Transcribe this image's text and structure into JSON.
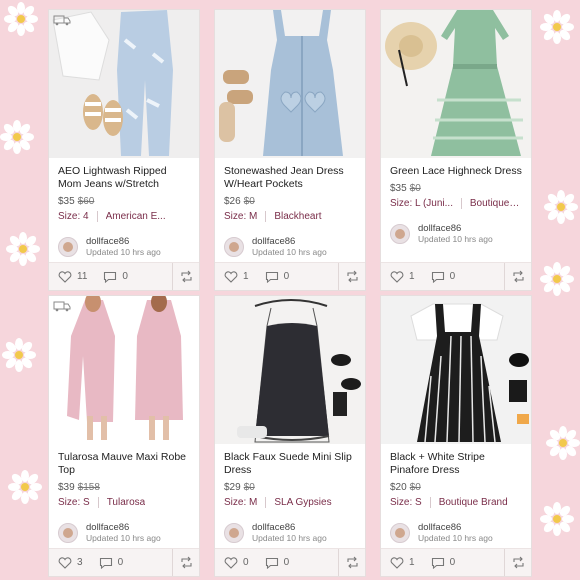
{
  "listings": [
    {
      "title": "AEO Lightwash Ripped Mom Jeans w/Stretch",
      "price": "$35",
      "original_price": "$60",
      "size": "Size: 4",
      "brand": "American E...",
      "likes": "11",
      "comments": "0",
      "seller": "dollface86",
      "updated": "Updated 10 hrs ago",
      "ship_badge": true
    },
    {
      "title": "Stonewashed Jean Dress W/Heart Pockets",
      "price": "$26",
      "original_price": "$0",
      "size": "Size: M",
      "brand": "Blackheart",
      "likes": "1",
      "comments": "0",
      "seller": "dollface86",
      "updated": "Updated 10 hrs ago",
      "ship_badge": false
    },
    {
      "title": "Green Lace Highneck Dress",
      "price": "$35",
      "original_price": "$0",
      "size": "Size: L (Juni...",
      "brand": "Boutique Br...",
      "likes": "1",
      "comments": "0",
      "seller": "dollface86",
      "updated": "Updated 10 hrs ago",
      "ship_badge": false
    },
    {
      "title": "Tularosa Mauve Maxi Robe Top",
      "price": "$39",
      "original_price": "$158",
      "size": "Size: S",
      "brand": "Tularosa",
      "likes": "3",
      "comments": "0",
      "seller": "dollface86",
      "updated": "Updated 10 hrs ago",
      "ship_badge": true
    },
    {
      "title": "Black Faux Suede Mini Slip Dress",
      "price": "$29",
      "original_price": "$0",
      "size": "Size: M",
      "brand": "SLA Gypsies",
      "likes": "0",
      "comments": "0",
      "seller": "dollface86",
      "updated": "Updated 10 hrs ago",
      "ship_badge": false
    },
    {
      "title": "Black + White Stripe Pinafore Dress",
      "price": "$20",
      "original_price": "$0",
      "size": "Size: S",
      "brand": "Boutique Brand",
      "likes": "1",
      "comments": "0",
      "seller": "dollface86",
      "updated": "Updated 10 hrs ago",
      "ship_badge": false
    }
  ],
  "colors": {
    "background": "#f6d6dc",
    "brand_text": "#7a2e4a",
    "card": "#ffffff"
  },
  "icons": {
    "like": "heart-icon",
    "comment": "comment-icon",
    "share": "share-icon",
    "shipping": "truck-icon"
  }
}
